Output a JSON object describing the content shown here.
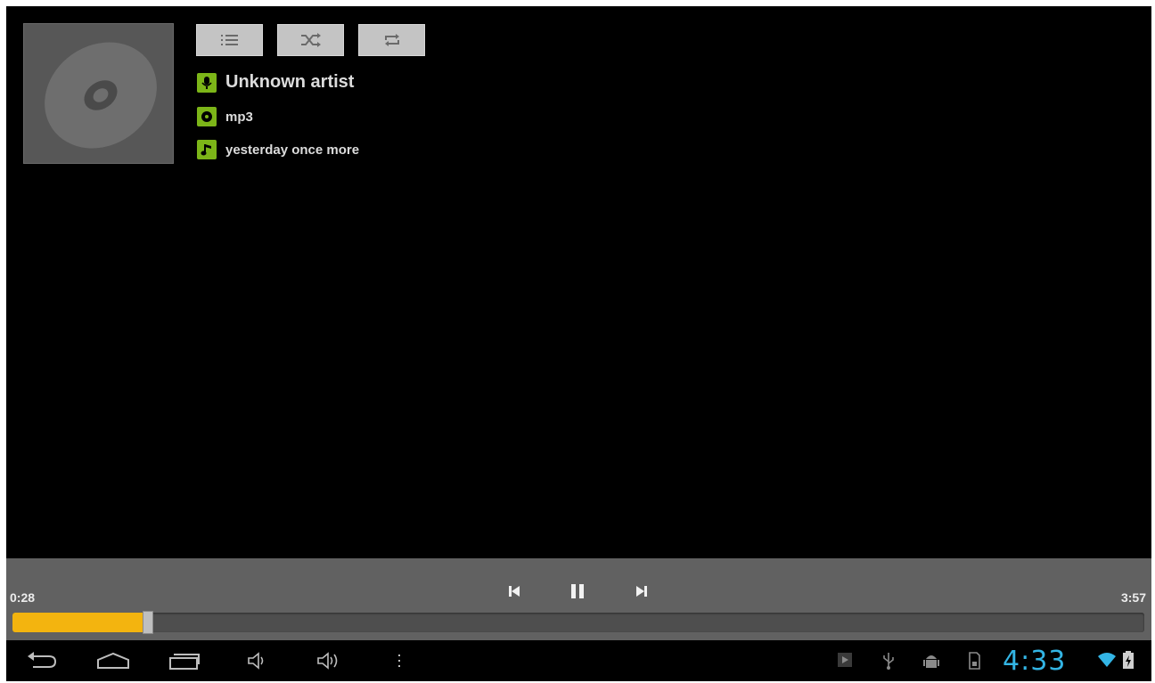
{
  "track": {
    "artist": "Unknown artist",
    "album": "mp3",
    "title": "yesterday once more"
  },
  "mode_buttons": [
    {
      "icon": "playlist-icon"
    },
    {
      "icon": "shuffle-icon"
    },
    {
      "icon": "repeat-icon"
    }
  ],
  "playback": {
    "elapsed": "0:28",
    "duration": "3:57",
    "progress_fraction": 0.12
  },
  "status_bar": {
    "clock": "4:33"
  },
  "colors": {
    "accent_green": "#7cb518",
    "progress": "#f3b40f",
    "clock": "#33b5e5"
  }
}
